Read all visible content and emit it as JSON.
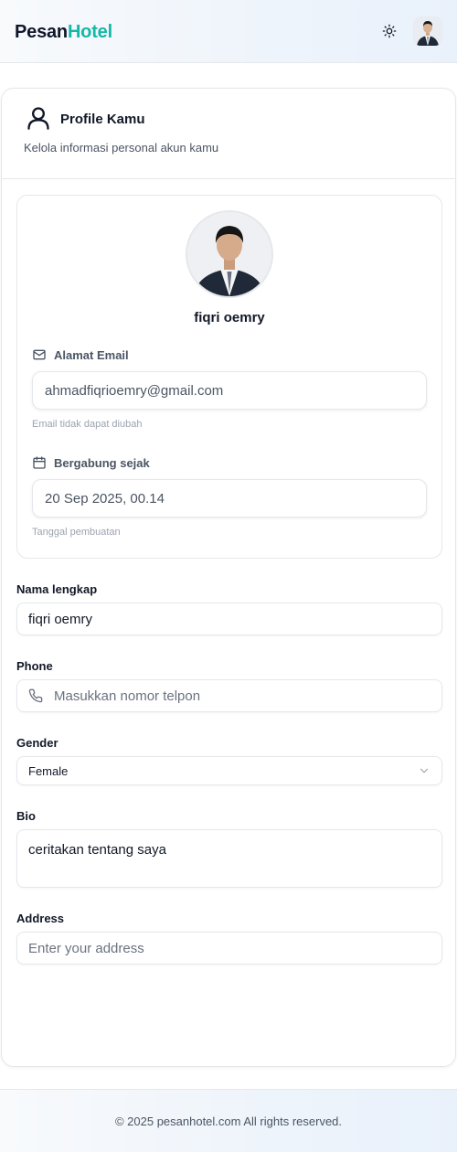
{
  "header": {
    "brand_part1": "Pesan",
    "brand_part2": "Hotel",
    "theme_icon": "sun-icon",
    "avatar_icon": "user-avatar"
  },
  "profile": {
    "title": "Profile Kamu",
    "subtitle": "Kelola informasi personal akun kamu",
    "display_name": "fiqri oemry",
    "email_label": "Alamat Email",
    "email_value": "ahmadfiqrioemry@gmail.com",
    "email_hint": "Email tidak dapat diubah",
    "joined_label": "Bergabung sejak",
    "joined_value": "20 Sep 2025, 00.14",
    "joined_hint": "Tanggal pembuatan"
  },
  "form": {
    "fullname_label": "Nama lengkap",
    "fullname_value": "fiqri oemry",
    "phone_label": "Phone",
    "phone_placeholder": "Masukkan nomor telpon",
    "gender_label": "Gender",
    "gender_value": "Female",
    "bio_label": "Bio",
    "bio_value": "ceritakan tentang saya",
    "address_label": "Address",
    "address_placeholder": "Enter your address"
  },
  "footer": {
    "copyright": "© 2025 pesanhotel.com All rights reserved."
  },
  "colors": {
    "brand_accent": "#14b8a6",
    "text_primary": "#111827",
    "text_muted": "#4b5563",
    "border": "#e5e7eb"
  }
}
